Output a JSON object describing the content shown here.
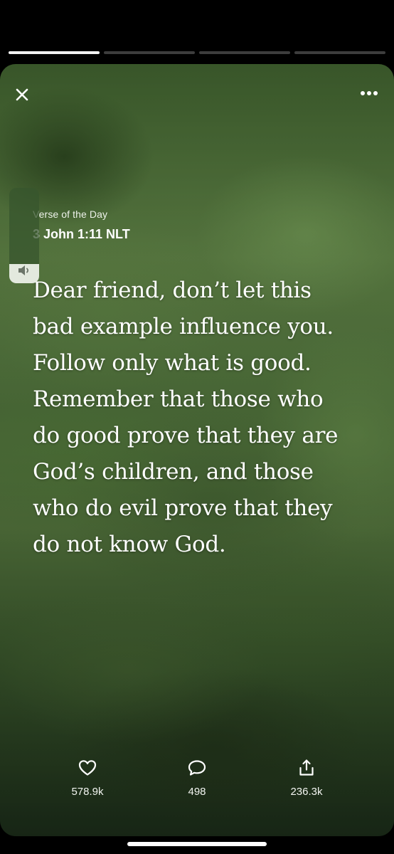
{
  "story": {
    "segments": [
      true,
      false,
      false,
      false
    ]
  },
  "header": {
    "label": "Verse of the Day",
    "reference": "3 John 1:11 NLT"
  },
  "verse": {
    "text": "Dear friend, don’t let this bad example influence you. Follow only what is good. Remember that those who do good prove that they are God’s children, and those who do evil prove that they do not know God."
  },
  "volume": {
    "level": 0.2
  },
  "actions": {
    "likes": "578.9k",
    "comments": "498",
    "shares": "236.3k"
  },
  "icons": {
    "close": "close-icon",
    "more": "more-dots-icon",
    "speaker": "speaker-icon",
    "like": "heart-icon",
    "comment": "comment-bubble-icon",
    "share": "share-icon"
  },
  "colors": {
    "progress_active": "#f2f2f2",
    "progress_inactive": "#3d3d3d",
    "text": "#ffffff"
  }
}
